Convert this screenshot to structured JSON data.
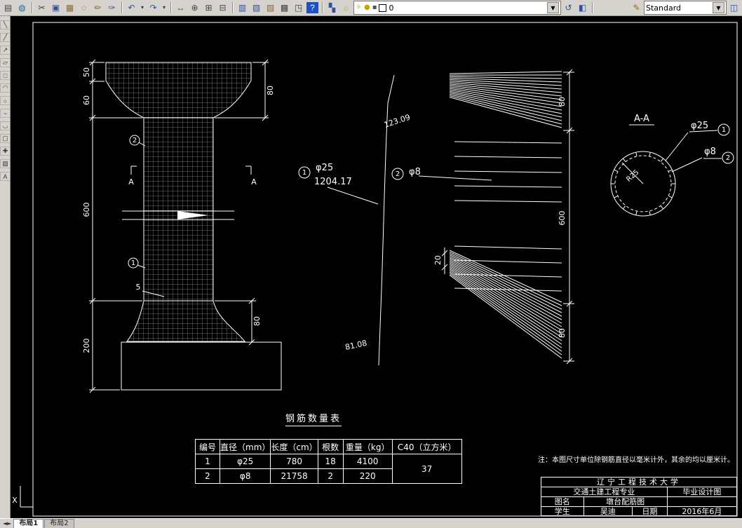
{
  "app": {
    "layer_value": "0",
    "text_style_value": "Standard",
    "ucs_label": "X"
  },
  "toolbar": {
    "items": [
      {
        "t": "i",
        "n": "print-icon",
        "g": "▤",
        "c": "#444"
      },
      {
        "t": "i",
        "n": "publish-web-icon",
        "g": "◍",
        "c": "#246a9a"
      },
      {
        "t": "sep"
      },
      {
        "t": "i",
        "n": "cut-icon",
        "g": "✂",
        "c": "#444"
      },
      {
        "t": "i",
        "n": "copy-icon",
        "g": "▣",
        "c": "#2a52a0"
      },
      {
        "t": "i",
        "n": "paste-icon",
        "g": "▦",
        "c": "#8a6a2a"
      },
      {
        "t": "i",
        "n": "erase-icon",
        "g": "◌",
        "c": "#b03030"
      },
      {
        "t": "i",
        "n": "pencil-edit-icon",
        "g": "✏",
        "c": "#8a6a2a"
      },
      {
        "t": "i",
        "n": "match-properties-icon",
        "g": "✑",
        "c": "#2a52a0"
      },
      {
        "t": "sep"
      },
      {
        "t": "i",
        "n": "undo-icon",
        "g": "↶",
        "c": "#2a52a0"
      },
      {
        "t": "i",
        "n": "undo-dropdown-arrow-icon",
        "g": "▾",
        "c": "#333",
        "narrow": true
      },
      {
        "t": "i",
        "n": "redo-icon",
        "g": "↷",
        "c": "#2a52a0"
      },
      {
        "t": "i",
        "n": "redo-dropdown-arrow-icon",
        "g": "▾",
        "c": "#333",
        "narrow": true
      },
      {
        "t": "sep"
      },
      {
        "t": "i",
        "n": "pan-icon",
        "g": "↔",
        "c": "#444"
      },
      {
        "t": "i",
        "n": "zoom-realtime-icon",
        "g": "⊕",
        "c": "#444"
      },
      {
        "t": "i",
        "n": "zoom-window-icon",
        "g": "⊞",
        "c": "#444"
      },
      {
        "t": "i",
        "n": "zoom-previous-icon",
        "g": "⊟",
        "c": "#444"
      },
      {
        "t": "sep"
      },
      {
        "t": "i",
        "n": "properties-icon",
        "g": "▥",
        "c": "#2a52a0"
      },
      {
        "t": "i",
        "n": "design-center-icon",
        "g": "▧",
        "c": "#2a52a0"
      },
      {
        "t": "i",
        "n": "tool-palettes-icon",
        "g": "▨",
        "c": "#8a6a2a"
      },
      {
        "t": "i",
        "n": "sheet-set-manager-icon",
        "g": "▩",
        "c": "#444"
      },
      {
        "t": "i",
        "n": "markup-set-manager-icon",
        "g": "◳",
        "c": "#444"
      },
      {
        "t": "i",
        "n": "help-icon",
        "g": "?",
        "c": "#fff",
        "bg": "#1b50c8"
      },
      {
        "t": "sep"
      },
      {
        "t": "i",
        "n": "layer-properties-manager-icon",
        "g": "▚",
        "c": "#2a52a0"
      },
      {
        "t": "i",
        "n": "layer-states-icon",
        "g": "☼",
        "c": "#c9a400"
      },
      {
        "t": "layer"
      },
      {
        "t": "i",
        "n": "layer-previous-icon",
        "g": "↺",
        "c": "#2a52a0"
      },
      {
        "t": "i",
        "n": "make-object-layer-current-icon",
        "g": "◧",
        "c": "#2a52a0"
      },
      {
        "t": "sep"
      },
      {
        "t": "spacer"
      },
      {
        "t": "i",
        "n": "text-style-icon",
        "g": "✎",
        "c": "#8a6a2a"
      },
      {
        "t": "style"
      },
      {
        "t": "i",
        "n": "dim-style-icon",
        "g": "◫",
        "c": "#2a52a0"
      }
    ],
    "layer_icons": [
      {
        "n": "layer-on-icon",
        "g": "☼",
        "c": "#c9a400"
      },
      {
        "n": "layer-freeze-icon",
        "g": "●",
        "c": "#c9a400"
      },
      {
        "n": "layer-lock-icon",
        "g": "▪",
        "c": "#555"
      }
    ]
  },
  "left_toolbar": {
    "items": [
      {
        "n": "line-tool-icon",
        "g": "╲"
      },
      {
        "n": "construction-line-tool-icon",
        "g": "╱"
      },
      {
        "n": "polyline-tool-icon",
        "g": "↗"
      },
      {
        "n": "polygon-tool-icon",
        "g": "▱"
      },
      {
        "n": "rectangle-tool-icon",
        "g": "□"
      },
      {
        "n": "arc-tool-icon",
        "g": "◠"
      },
      {
        "n": "circle-tool-icon",
        "g": "○"
      },
      {
        "n": "revision-cloud-tool-icon",
        "g": "~"
      },
      {
        "n": "spline-tool-icon",
        "g": "◡"
      },
      {
        "n": "ellipse-tool-icon",
        "g": "▢"
      },
      {
        "n": "insert-block-tool-icon",
        "g": "✚"
      },
      {
        "n": "hatch-tool-icon",
        "g": "▨"
      },
      {
        "n": "text-tool-icon",
        "g": "A"
      }
    ]
  },
  "drawing": {
    "pier": {
      "dim_50": "50",
      "dim_60": "60",
      "dim_600": "600",
      "dim_200": "200",
      "dim_80_top": "80",
      "dim_80_bottom": "80",
      "section_letter_left": "A",
      "section_letter_right": "A",
      "bubble_top": "2",
      "bubble_bottom": "1",
      "spacing_label": "5"
    },
    "main_bar": {
      "bubble": "1",
      "diameter": "φ25",
      "total_length": "1204.17",
      "top_segment": "123.09",
      "bottom_segment": "81.08"
    },
    "stirrup": {
      "bubble": "2",
      "diameter": "φ8",
      "dim_80_top": "80",
      "dim_600": "600",
      "dim_80_bottom": "80",
      "dim_20": "20"
    },
    "section": {
      "title": "A-A",
      "radius_label": "R25",
      "bar1_diameter": "φ25",
      "bar1_bubble": "1",
      "bar2_diameter": "φ8",
      "bar2_bubble": "2"
    },
    "note": "注：本图尺寸单位除钢筋直径以毫米计外，其余的均以厘米计。"
  },
  "table": {
    "title": "钢筋数量表",
    "headers": [
      "编号",
      "直径（mm）",
      "长度（cm）",
      "根数",
      "重量（kg）",
      "C40（立方米）"
    ],
    "rows": [
      [
        "1",
        "φ25",
        "780",
        "18",
        "4100"
      ],
      [
        "2",
        "φ8",
        "21758",
        "2",
        "220"
      ]
    ],
    "c40_value": "37"
  },
  "title_block": {
    "university": "辽宁工程技术大学",
    "major": "交通土建工程专业",
    "doc_type": "毕业设计图",
    "name_label": "图名",
    "drawing_name": "墩台配筋图",
    "student_label": "学生",
    "student_name": "吴迪",
    "date_label": "日期",
    "date_value": "2016年6月"
  },
  "tabs": {
    "items": [
      "布局1",
      "布局2"
    ],
    "active": 0
  }
}
